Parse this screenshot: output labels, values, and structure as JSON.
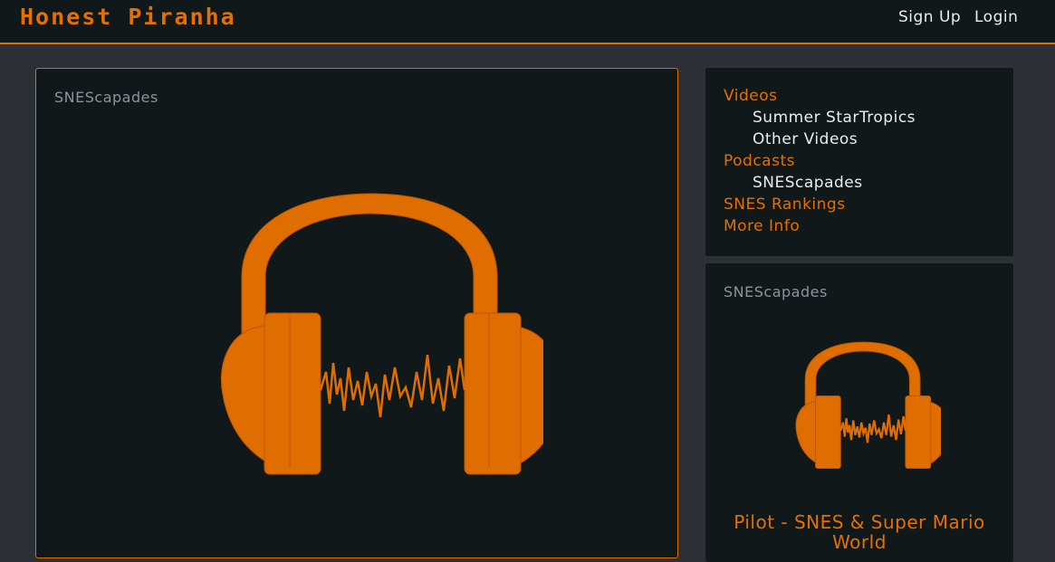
{
  "header": {
    "brand": "Honest Piranha",
    "signup_label": "Sign Up",
    "login_label": "Login"
  },
  "main": {
    "card_title": "SNEScapades",
    "image_icon": "headphones-waveform-icon"
  },
  "sidebar": {
    "nav": [
      {
        "label": "Videos",
        "level": 0
      },
      {
        "label": "Summer StarTropics",
        "level": 1
      },
      {
        "label": "Other Videos",
        "level": 1
      },
      {
        "label": "Podcasts",
        "level": 0
      },
      {
        "label": "SNEScapades",
        "level": 1
      },
      {
        "label": "SNES Rankings",
        "level": 0
      },
      {
        "label": "More Info",
        "level": 0
      }
    ],
    "podcast_card": {
      "title": "SNEScapades",
      "episode_title": "Pilot - SNES & Super Mario World",
      "image_icon": "headphones-waveform-icon"
    }
  },
  "colors": {
    "accent": "#e56f00",
    "background": "#2c2f35",
    "panel": "#10181a",
    "text_light": "#e9edee",
    "text_muted": "#8c9498"
  }
}
